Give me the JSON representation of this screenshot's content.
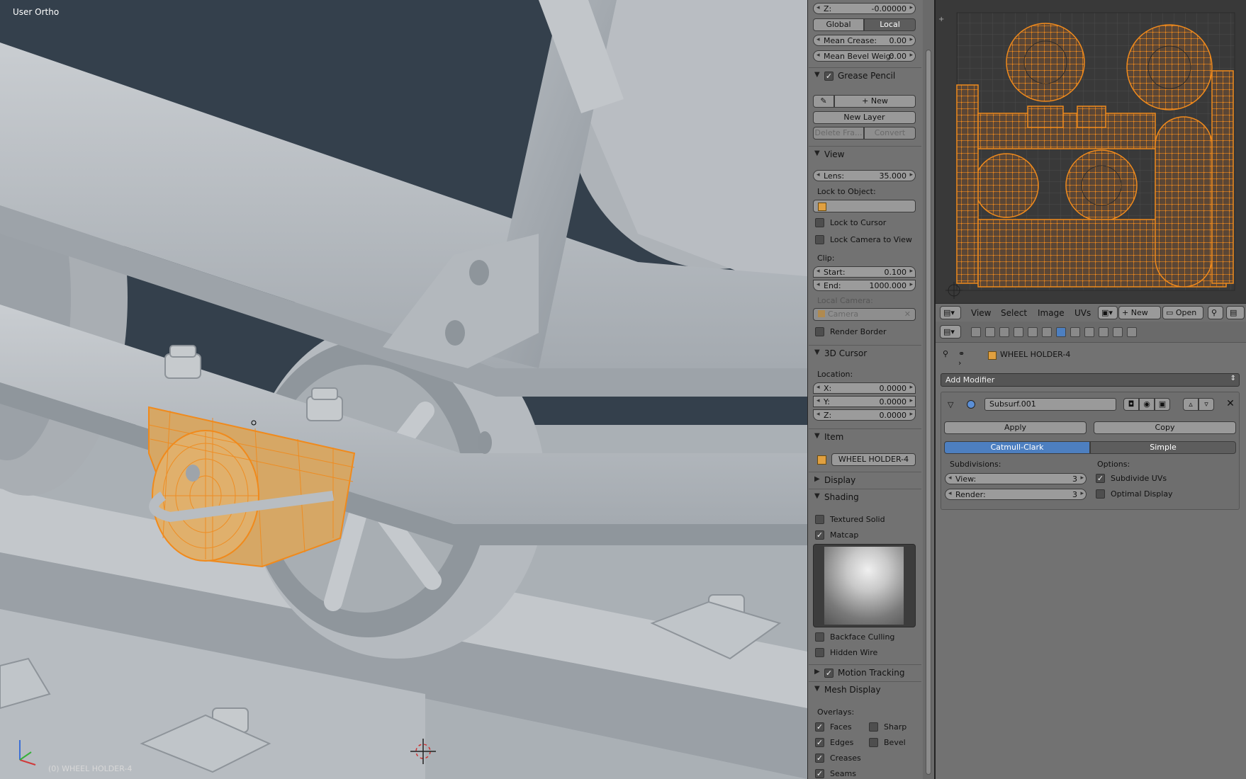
{
  "viewport": {
    "mode_label": "User Ortho",
    "object_label": "(0) WHEEL HOLDER-4"
  },
  "transform": {
    "z_label": "Z:",
    "z_value": "-0.00000",
    "global_label": "Global",
    "local_label": "Local",
    "mean_crease_label": "Mean Crease:",
    "mean_crease_value": "0.00",
    "mean_bevel_label": "Mean Bevel Weig:",
    "mean_bevel_value": "0.00"
  },
  "grease_pencil": {
    "title": "Grease Pencil",
    "enabled": true,
    "new_label": "New",
    "new_layer_label": "New Layer",
    "delete_frame_label": "Delete Fra...",
    "convert_label": "Convert"
  },
  "view_panel": {
    "title": "View",
    "lens_label": "Lens:",
    "lens_value": "35.000",
    "lock_to_object_label": "Lock to Object:",
    "lock_to_cursor_label": "Lock to Cursor",
    "lock_camera_label": "Lock Camera to View",
    "clip_label": "Clip:",
    "start_label": "Start:",
    "start_value": "0.100",
    "end_label": "End:",
    "end_value": "1000.000",
    "local_camera_label": "Local Camera:",
    "camera_value": "Camera",
    "render_border_label": "Render Border"
  },
  "cursor_panel": {
    "title": "3D Cursor",
    "location_label": "Location:",
    "x_label": "X:",
    "x_value": "0.0000",
    "y_label": "Y:",
    "y_value": "0.0000",
    "z_label": "Z:",
    "z_value": "0.0000"
  },
  "item_panel": {
    "title": "Item",
    "name": "WHEEL HOLDER-4"
  },
  "display_panel": {
    "title": "Display"
  },
  "shading_panel": {
    "title": "Shading",
    "textured_solid_label": "Textured Solid",
    "textured_solid": false,
    "matcap_label": "Matcap",
    "matcap": true,
    "backface_culling_label": "Backface Culling",
    "hidden_wire_label": "Hidden Wire"
  },
  "motion_tracking_panel": {
    "title": "Motion Tracking",
    "enabled": true
  },
  "mesh_display_panel": {
    "title": "Mesh Display",
    "overlays_label": "Overlays:",
    "faces_label": "Faces",
    "sharp_label": "Sharp",
    "edges_label": "Edges",
    "bevel_label": "Bevel",
    "creases_label": "Creases",
    "seams_label": "Seams"
  },
  "uv_header": {
    "menu": [
      "View",
      "Select",
      "Image",
      "UVs"
    ],
    "new_label": "New",
    "open_label": "Open"
  },
  "properties": {
    "object_name": "WHEEL HOLDER-4",
    "add_modifier_label": "Add Modifier",
    "modifier_name": "Subsurf.001",
    "apply_label": "Apply",
    "copy_label": "Copy",
    "catmull_label": "Catmull-Clark",
    "simple_label": "Simple",
    "subdivisions_label": "Subdivisions:",
    "options_label": "Options:",
    "view_label": "View:",
    "view_value": "3",
    "render_label": "Render:",
    "render_value": "3",
    "subdivide_uvs_label": "Subdivide UVs",
    "subdivide_uvs": true,
    "optimal_display_label": "Optimal Display",
    "optimal_display": false
  },
  "colors": {
    "accent_blue": "#4d7fc0",
    "selection_orange": "#f08a1c",
    "panel_gray": "#727272",
    "viewport_bg": "#34404c"
  }
}
